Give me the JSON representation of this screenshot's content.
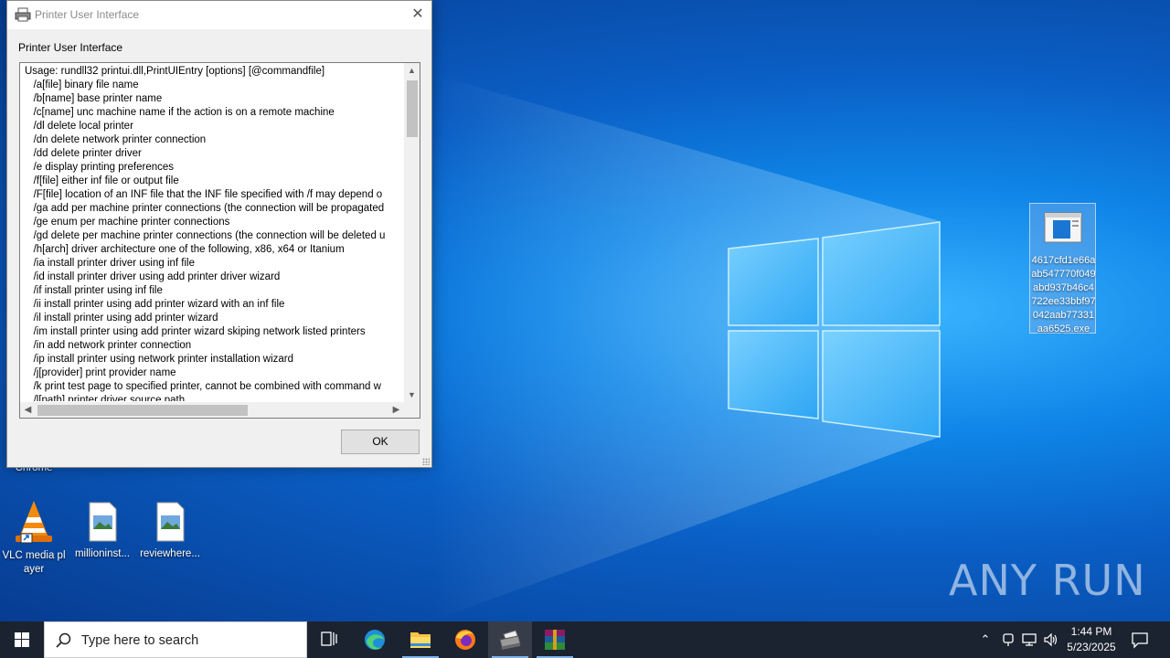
{
  "dialog": {
    "title": "Printer User Interface",
    "heading": "Printer User Interface",
    "ok_label": "OK",
    "usage_lines": [
      "Usage: rundll32 printui.dll,PrintUIEntry [options] [@commandfile]",
      "   /a[file] binary file name",
      "   /b[name] base printer name",
      "   /c[name] unc machine name if the action is on a remote machine",
      "   /dl delete local printer",
      "   /dn delete network printer connection",
      "   /dd delete printer driver",
      "   /e display printing preferences",
      "   /f[file] either inf file or output file",
      "   /F[file] location of an INF file that the INF file specified with /f may depend o",
      "   /ga add per machine printer connections (the connection will be propagated",
      "   /ge enum per machine printer connections",
      "   /gd delete per machine printer connections (the connection will be deleted u",
      "   /h[arch] driver architecture one of the following, x86, x64 or Itanium",
      "   /ia install printer driver using inf file",
      "   /id install printer driver using add printer driver wizard",
      "   /if install printer using inf file",
      "   /ii install printer using add printer wizard with an inf file",
      "   /il install printer using add printer wizard",
      "   /im install printer using add printer wizard skiping network listed printers",
      "   /in add network printer connection",
      "   /ip install printer using network printer installation wizard",
      "   /j[provider] print provider name",
      "   /k print test page to specified printer, cannot be combined with command w",
      "   /l[path] printer driver source path"
    ]
  },
  "desktop": {
    "chrome_label": "Chrome",
    "vlc_label": "VLC media player",
    "file1_label": "millioninst...",
    "file2_label": "reviewhere...",
    "exe_label": "4617cfd1e66aab547770f049abd937b46c4722ee33bbf97042aab77331aa6525.exe",
    "watermark": "ANY RUN"
  },
  "taskbar": {
    "search_placeholder": "Type here to search",
    "time": "1:44 PM",
    "date": "5/23/2025"
  },
  "colors": {
    "taskbar_bg": "#1b2330",
    "accent": "#0078d7",
    "desktop_bg": "#0a5ec4"
  }
}
